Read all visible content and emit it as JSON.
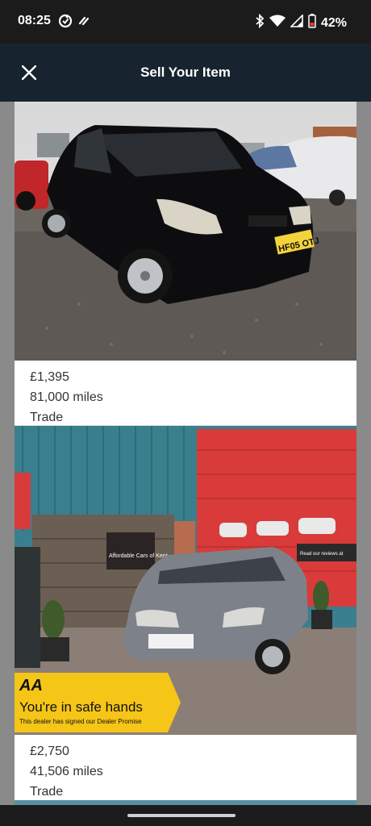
{
  "status_bar": {
    "time": "08:25",
    "battery": "42%",
    "icons": [
      "sync-icon",
      "nfc-icon",
      "bluetooth-icon",
      "wifi-icon",
      "signal-icon",
      "battery-icon"
    ]
  },
  "header": {
    "title": "Sell Your Item",
    "close_icon": "close-icon"
  },
  "listings": [
    {
      "plate": "HF05 OTJ",
      "price": "£1,395",
      "mileage": "81,000 miles",
      "seller_type": "Trade"
    },
    {
      "price": "£2,750",
      "mileage": "41,506 miles",
      "seller_type": "Trade",
      "banner_logo": "AA",
      "banner_headline": "You're in safe hands",
      "banner_subtext": "This dealer has signed our Dealer Promise",
      "sign_text": "Affordable Cars of Kent",
      "door_sign_text": "Read our reviews at",
      "plate": "Affordable Cars of Kent"
    }
  ],
  "colors": {
    "header_bg": "#17242f",
    "status_bg": "#1b1b1b",
    "aa_yellow": "#f5c518"
  }
}
